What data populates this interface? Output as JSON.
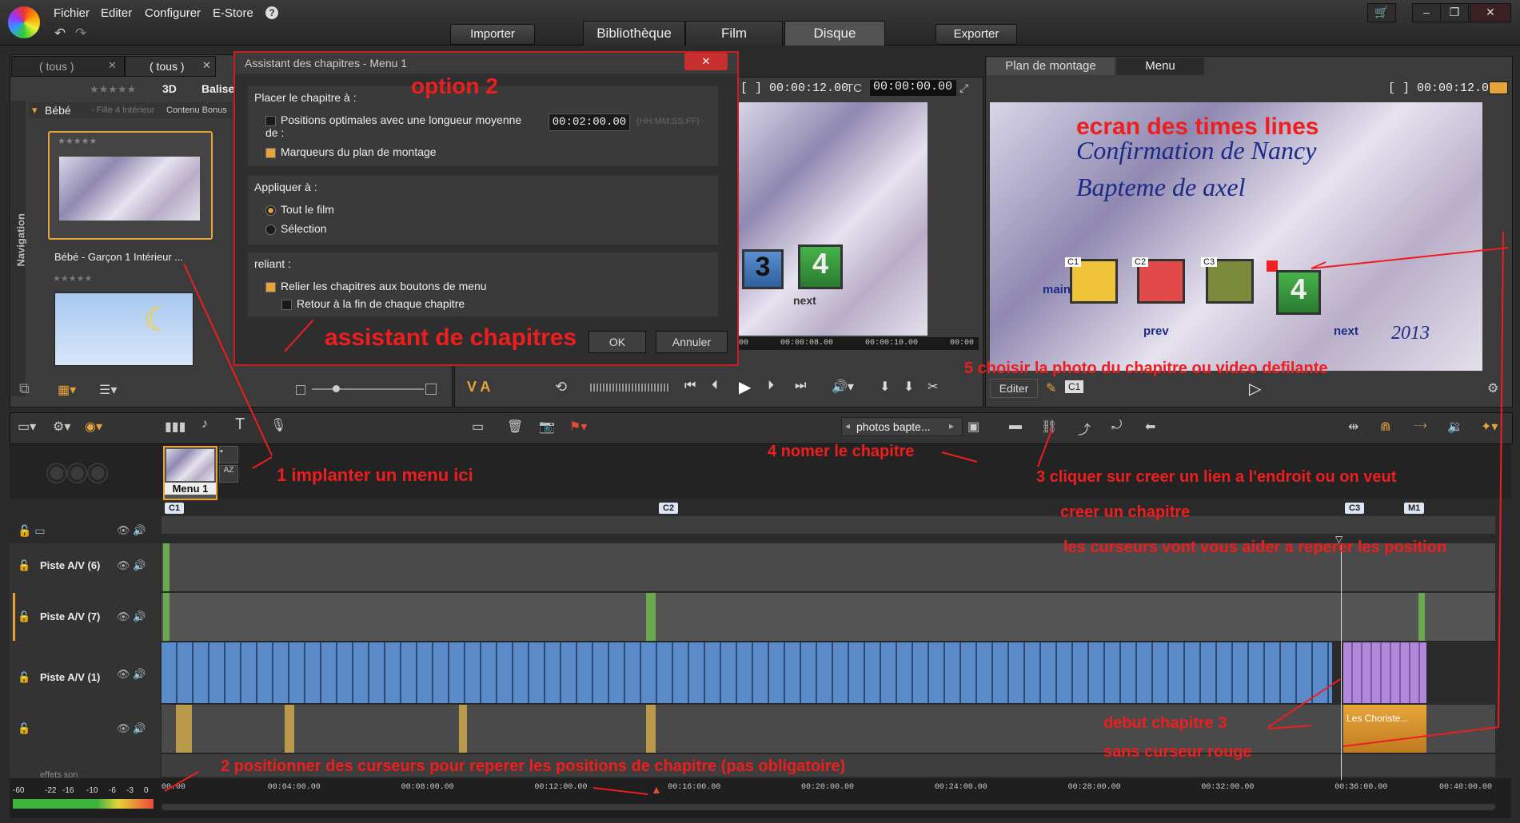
{
  "menu": [
    "Fichier",
    "Editer",
    "Configurer",
    "E-Store"
  ],
  "top_buttons": {
    "import": "Importer",
    "export": "Exporter"
  },
  "tabs": [
    "Bibliothèque",
    "Film",
    "Disque"
  ],
  "library": {
    "tab1": "( tous )",
    "tab2": "( tous )",
    "filter_3d": "3D",
    "filter_balise": "Balise",
    "folder": "Bébé",
    "folder_sub": "- Fille 4 Intérieur",
    "col_header": "Contenu Bonus",
    "item1": "Bébé - Garçon 1 Intérieur ...",
    "nav_label": "Navigation"
  },
  "dialog": {
    "title": "Assistant des chapitres - Menu 1",
    "sec1_label": "Placer le chapitre à :",
    "opt1": "Positions optimales avec une longueur moyenne de :",
    "duration": "00:02:00.00",
    "duration_fmt": "(HH:MM:SS:FF)",
    "opt2": "Marqueurs du plan de montage",
    "sec2_label": "Appliquer à :",
    "radio1": "Tout le film",
    "radio2": "Sélection",
    "sec3_label": "reliant :",
    "link1": "Relier les chapitres aux boutons de menu",
    "link2": "Retour à la fin de chaque chapitre",
    "ok": "OK",
    "cancel": "Annuler"
  },
  "player": {
    "tc1": "[ ] 00:00:12.00",
    "tc_label": "TC",
    "tc2": "00:00:00.00",
    "ruler": [
      "00",
      "00:00:08.00",
      "00:00:10.00",
      "00:00"
    ],
    "va": "V A",
    "menu_next": "next"
  },
  "right_panel": {
    "tab_plan": "Plan de montage",
    "tab_menu": "Menu",
    "tc": "[ ] 00:00:12.00",
    "edit": "Editer",
    "chip": "C1",
    "menu_title1": "Confirmation de Nancy",
    "menu_title2": "Bapteme de axel",
    "main": "main",
    "prev": "prev",
    "next": "next",
    "year": "2013",
    "chapters": [
      "C1",
      "C2",
      "C3"
    ]
  },
  "toolbar": {
    "photos": "photos bapte..."
  },
  "menu_thumb": "Menu 1",
  "chapters": [
    "C1",
    "C2",
    "C3",
    "M1"
  ],
  "tracks": [
    "Piste A/V (6)",
    "Piste A/V (7)",
    "Piste A/V (1)",
    "",
    "effets son"
  ],
  "clip_label": "Les Choriste...",
  "meter": [
    "-60",
    "-22",
    "-16",
    "-10",
    "-6",
    "-3",
    "0"
  ],
  "ruler": [
    "00.00",
    "00:04:00.00",
    "00:08:00.00",
    "00:12:00.00",
    "00:16:00.00",
    "00:20:00.00",
    "00:24:00.00",
    "00:28:00.00",
    "00:32:00.00",
    "00:36:00.00",
    "00:40:00.00"
  ],
  "annotations": {
    "option2": "option 2",
    "assistant": "assistant de chapitres",
    "ecran": "ecran des times lines",
    "step5": "5 choisir la photo du chapitre ou video defilante",
    "step4": "4 nomer le chapitre",
    "step1": "1 implanter un menu ici",
    "step3a": "3  cliquer sur creer un lien a l'endroit ou on veut",
    "step3b": "creer un chapitre",
    "curseurs": "les curseurs vont vous aider a reperer les position",
    "debut": "debut chapitre 3",
    "sans": "sans curseur rouge",
    "step2": "2 positionner des curseurs pour reperer les positions de chapitre (pas obligatoire)"
  },
  "colors": {
    "accent": "#e8a23a",
    "annotation": "#ee1e1e",
    "chapter_purple": "#b08ad8"
  }
}
